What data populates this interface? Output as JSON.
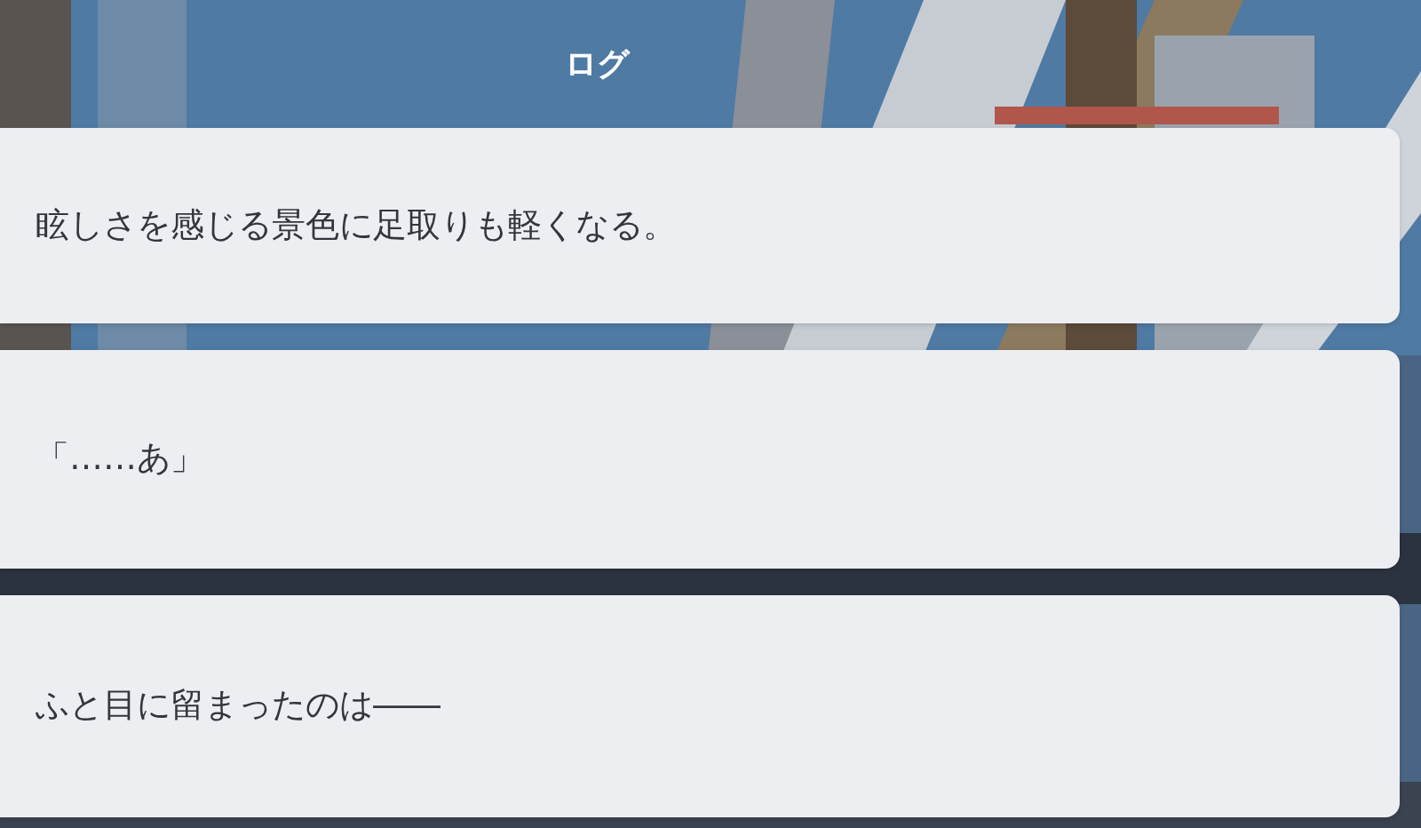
{
  "title": "ログ",
  "entries": [
    {
      "text": "眩しさを感じる景色に足取りも軽くなる。"
    },
    {
      "text": "「……あ」"
    },
    {
      "text": "ふと目に留まったのは――"
    }
  ]
}
